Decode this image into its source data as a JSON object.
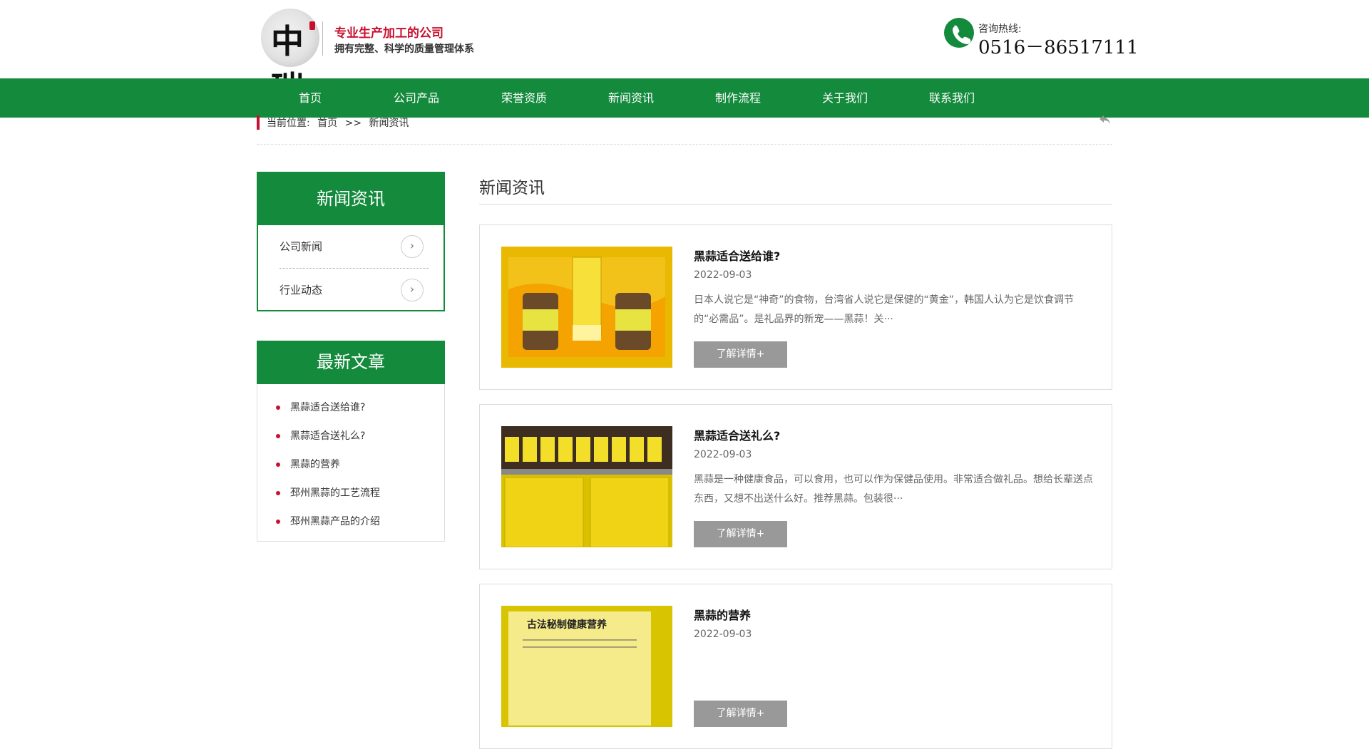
{
  "header": {
    "logo_alt": "中瑞",
    "slogan_main": "专业生产加工的公司",
    "slogan_sub": "拥有完整、科学的质量管理体系",
    "hotline_label": "咨询热线:",
    "hotline_number": "0516－86517111"
  },
  "nav": {
    "items": [
      "首页",
      "公司产品",
      "荣誉资质",
      "新闻资讯",
      "制作流程",
      "关于我们",
      "联系我们"
    ]
  },
  "breadcrumb": {
    "label": "当前位置:",
    "home": "首页",
    "separator": ">>",
    "current": "新闻资讯"
  },
  "sidebar": {
    "category_title": "新闻资讯",
    "categories": [
      "公司新闻",
      "行业动态"
    ],
    "latest_title": "最新文章",
    "latest": [
      "黑蒜适合送给谁?",
      "黑蒜适合送礼么?",
      "黑蒜的营养",
      "邳州黑蒜的工艺流程",
      "邳州黑蒜产品的介绍"
    ]
  },
  "main": {
    "title": "新闻资讯",
    "articles": [
      {
        "title": "黑蒜适合送给谁?",
        "date": "2022-09-03",
        "summary": "日本人说它是“神奇”的食物，台湾省人说它是保健的“黄金”，韩国人认为它是饮食调节的“必需品”。是礼品界的新宠——黑蒜！关···",
        "button": "了解详情+"
      },
      {
        "title": "黑蒜适合送礼么?",
        "date": "2022-09-03",
        "summary": "黑蒜是一种健康食品，可以食用，也可以作为保健品使用。非常适合做礼品。想给长辈送点东西，又想不出送什么好。推荐黑蒜。包装很···",
        "button": "了解详情+"
      },
      {
        "title": "黑蒜的营养",
        "date": "2022-09-03",
        "summary": "",
        "image_text": "古法秘制健康营养",
        "button": "了解详情+"
      }
    ]
  },
  "colors": {
    "brand_green": "#148a3c",
    "accent_red": "#c8102e",
    "button_gray": "#999999"
  }
}
